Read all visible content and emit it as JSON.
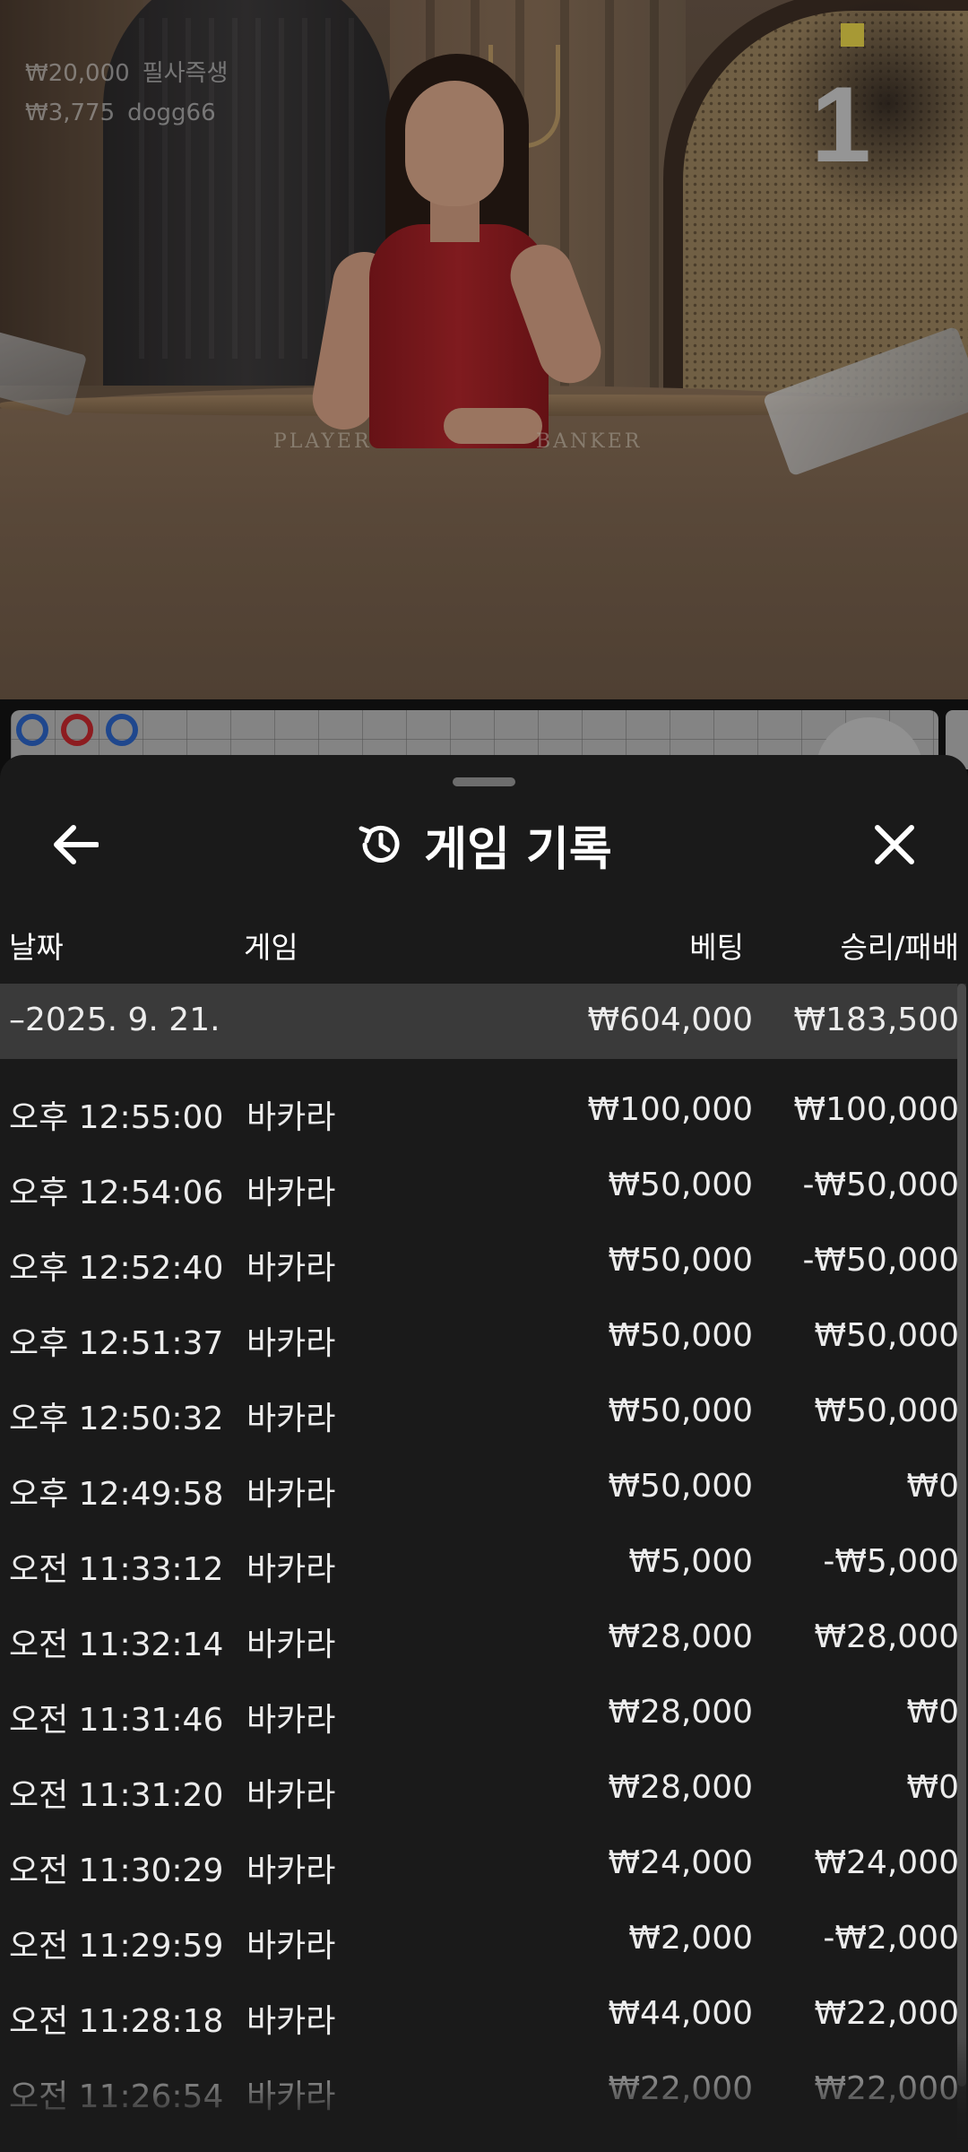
{
  "video": {
    "bet_lines": [
      {
        "amount": "₩20,000",
        "user": "필사즉생"
      },
      {
        "amount": "₩3,775",
        "user": "dogg66"
      }
    ],
    "round_number": "1",
    "table_labels": {
      "player": "PLAYER",
      "banker": "BANKER"
    },
    "roadmap_dots": [
      "#2b63c4",
      "#c4272d",
      "#2b63c4"
    ]
  },
  "history": {
    "title": "게임 기록",
    "icons": {
      "back": "arrow-left-icon",
      "history": "history-clock-icon",
      "close": "close-x-icon"
    },
    "columns": {
      "date": "날짜",
      "game": "게임",
      "bet": "베팅",
      "result": "승리/패배"
    },
    "day_summary": {
      "date": "–2025. 9. 21.",
      "bet": "₩604,000",
      "result": "₩183,500"
    },
    "rows": [
      {
        "time": "오후 12:55:00",
        "game": "바카라",
        "bet": "₩100,000",
        "result": "₩100,000"
      },
      {
        "time": "오후 12:54:06",
        "game": "바카라",
        "bet": "₩50,000",
        "result": "-₩50,000"
      },
      {
        "time": "오후 12:52:40",
        "game": "바카라",
        "bet": "₩50,000",
        "result": "-₩50,000"
      },
      {
        "time": "오후 12:51:37",
        "game": "바카라",
        "bet": "₩50,000",
        "result": "₩50,000"
      },
      {
        "time": "오후 12:50:32",
        "game": "바카라",
        "bet": "₩50,000",
        "result": "₩50,000"
      },
      {
        "time": "오후 12:49:58",
        "game": "바카라",
        "bet": "₩50,000",
        "result": "₩0"
      },
      {
        "time": "오전 11:33:12",
        "game": "바카라",
        "bet": "₩5,000",
        "result": "-₩5,000"
      },
      {
        "time": "오전 11:32:14",
        "game": "바카라",
        "bet": "₩28,000",
        "result": "₩28,000"
      },
      {
        "time": "오전 11:31:46",
        "game": "바카라",
        "bet": "₩28,000",
        "result": "₩0"
      },
      {
        "time": "오전 11:31:20",
        "game": "바카라",
        "bet": "₩28,000",
        "result": "₩0"
      },
      {
        "time": "오전 11:30:29",
        "game": "바카라",
        "bet": "₩24,000",
        "result": "₩24,000"
      },
      {
        "time": "오전 11:29:59",
        "game": "바카라",
        "bet": "₩2,000",
        "result": "-₩2,000"
      },
      {
        "time": "오전 11:28:18",
        "game": "바카라",
        "bet": "₩44,000",
        "result": "₩22,000"
      },
      {
        "time": "오전 11:26:54",
        "game": "바카라",
        "bet": "₩22,000",
        "result": "₩22,000"
      }
    ]
  }
}
